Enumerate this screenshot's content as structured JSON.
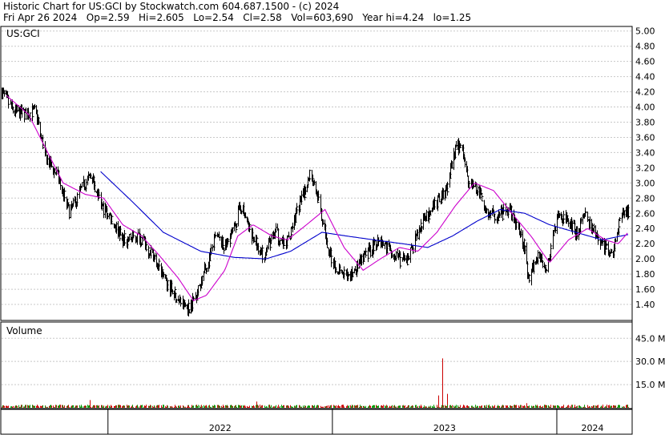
{
  "header": {
    "line1": "Historic Chart for US:GCI by Stockwatch.com 604.687.1500 - (c) 2024",
    "line2": "Fri Apr 26 2024   Op=2.59   Hi=2.605   Lo=2.54   Cl=2.58   Vol=603,690   Year hi=4.24   lo=1.25"
  },
  "chart_data": {
    "type": "line",
    "title": "US:GCI",
    "price_panel_label": "US:GCI",
    "volume_panel_label": "Volume",
    "ylim": [
      1.2,
      5.05
    ],
    "price_ticks": [
      "5.00",
      "4.80",
      "4.60",
      "4.40",
      "4.20",
      "4.00",
      "3.80",
      "3.60",
      "3.40",
      "3.20",
      "3.00",
      "2.80",
      "2.60",
      "2.40",
      "2.20",
      "2.00",
      "1.80",
      "1.60",
      "1.40"
    ],
    "volume_ylim": [
      0,
      55
    ],
    "volume_ticks": [
      "45.0 M",
      "30.0 M",
      "15.0 M"
    ],
    "x_tick_labels": [
      "2022",
      "2023",
      "2024"
    ],
    "x_tick_dates": [
      "2022-01-01",
      "2023-01-01",
      "2024-01-01"
    ],
    "x_start": "2021-07-12",
    "x_end": "2024-04-26",
    "colors": {
      "ma_fast": "#cc00cc",
      "ma_slow": "#0000cc",
      "bar": "#000000",
      "vol_up": "#009900",
      "vol_down": "#cc0000"
    },
    "price_anchors": [
      [
        "2021-07-12",
        4.2
      ],
      [
        "2021-07-30",
        3.95
      ],
      [
        "2021-08-20",
        3.9
      ],
      [
        "2021-09-05",
        3.95
      ],
      [
        "2021-09-20",
        3.35
      ],
      [
        "2021-10-10",
        3.1
      ],
      [
        "2021-10-30",
        2.6
      ],
      [
        "2021-11-20",
        2.95
      ],
      [
        "2021-12-05",
        3.1
      ],
      [
        "2021-12-20",
        2.7
      ],
      [
        "2022-01-05",
        2.55
      ],
      [
        "2022-01-25",
        2.25
      ],
      [
        "2022-02-20",
        2.3
      ],
      [
        "2022-03-15",
        2.05
      ],
      [
        "2022-04-05",
        1.7
      ],
      [
        "2022-04-25",
        1.45
      ],
      [
        "2022-05-12",
        1.35
      ],
      [
        "2022-05-25",
        1.55
      ],
      [
        "2022-06-10",
        1.9
      ],
      [
        "2022-06-25",
        2.3
      ],
      [
        "2022-07-10",
        2.15
      ],
      [
        "2022-07-25",
        2.4
      ],
      [
        "2022-08-05",
        2.7
      ],
      [
        "2022-08-20",
        2.35
      ],
      [
        "2022-09-10",
        2.05
      ],
      [
        "2022-09-30",
        2.35
      ],
      [
        "2022-10-15",
        2.15
      ],
      [
        "2022-11-01",
        2.55
      ],
      [
        "2022-11-15",
        2.85
      ],
      [
        "2022-11-25",
        3.15
      ],
      [
        "2022-12-05",
        2.9
      ],
      [
        "2022-12-15",
        2.5
      ],
      [
        "2022-12-28",
        2.05
      ],
      [
        "2023-01-10",
        1.85
      ],
      [
        "2023-01-25",
        1.75
      ],
      [
        "2023-02-10",
        1.9
      ],
      [
        "2023-02-25",
        2.05
      ],
      [
        "2023-03-15",
        2.25
      ],
      [
        "2023-04-01",
        2.15
      ],
      [
        "2023-04-15",
        2.0
      ],
      [
        "2023-05-01",
        1.95
      ],
      [
        "2023-05-15",
        2.25
      ],
      [
        "2023-06-01",
        2.55
      ],
      [
        "2023-06-20",
        2.75
      ],
      [
        "2023-07-05",
        2.9
      ],
      [
        "2023-07-20",
        3.45
      ],
      [
        "2023-07-31",
        3.5
      ],
      [
        "2023-08-10",
        3.0
      ],
      [
        "2023-08-25",
        2.9
      ],
      [
        "2023-09-10",
        2.6
      ],
      [
        "2023-09-25",
        2.55
      ],
      [
        "2023-10-15",
        2.65
      ],
      [
        "2023-10-30",
        2.4
      ],
      [
        "2023-11-10",
        2.15
      ],
      [
        "2023-11-15",
        1.75
      ],
      [
        "2023-11-30",
        2.05
      ],
      [
        "2023-12-15",
        1.9
      ],
      [
        "2024-01-01",
        2.55
      ],
      [
        "2024-01-15",
        2.55
      ],
      [
        "2024-02-01",
        2.35
      ],
      [
        "2024-02-15",
        2.55
      ],
      [
        "2024-03-01",
        2.35
      ],
      [
        "2024-03-15",
        2.2
      ],
      [
        "2024-03-30",
        2.05
      ],
      [
        "2024-04-10",
        2.4
      ],
      [
        "2024-04-20",
        2.7
      ],
      [
        "2024-04-26",
        2.58
      ]
    ],
    "ma_fast_anchors": [
      [
        "2021-07-20",
        4.15
      ],
      [
        "2021-08-25",
        3.9
      ],
      [
        "2021-09-25",
        3.4
      ],
      [
        "2021-10-20",
        3.0
      ],
      [
        "2021-11-25",
        2.85
      ],
      [
        "2021-12-25",
        2.8
      ],
      [
        "2022-01-25",
        2.45
      ],
      [
        "2022-02-25",
        2.3
      ],
      [
        "2022-03-25",
        2.05
      ],
      [
        "2022-04-25",
        1.75
      ],
      [
        "2022-05-20",
        1.45
      ],
      [
        "2022-06-10",
        1.52
      ],
      [
        "2022-07-10",
        1.85
      ],
      [
        "2022-07-31",
        2.3
      ],
      [
        "2022-08-25",
        2.45
      ],
      [
        "2022-09-25",
        2.3
      ],
      [
        "2022-10-20",
        2.25
      ],
      [
        "2022-11-20",
        2.45
      ],
      [
        "2022-12-20",
        2.65
      ],
      [
        "2023-01-20",
        2.15
      ],
      [
        "2023-02-20",
        1.85
      ],
      [
        "2023-03-20",
        2.0
      ],
      [
        "2023-04-20",
        2.15
      ],
      [
        "2023-05-20",
        2.1
      ],
      [
        "2023-06-20",
        2.35
      ],
      [
        "2023-07-20",
        2.7
      ],
      [
        "2023-08-20",
        3.0
      ],
      [
        "2023-09-20",
        2.9
      ],
      [
        "2023-10-20",
        2.6
      ],
      [
        "2023-11-20",
        2.3
      ],
      [
        "2023-12-20",
        1.95
      ],
      [
        "2024-01-20",
        2.25
      ],
      [
        "2024-02-20",
        2.4
      ],
      [
        "2024-03-20",
        2.25
      ],
      [
        "2024-04-10",
        2.2
      ],
      [
        "2024-04-26",
        2.35
      ]
    ],
    "ma_slow_anchors": [
      [
        "2021-12-20",
        3.15
      ],
      [
        "2022-02-10",
        2.75
      ],
      [
        "2022-04-01",
        2.35
      ],
      [
        "2022-06-01",
        2.1
      ],
      [
        "2022-07-25",
        2.02
      ],
      [
        "2022-09-15",
        2.0
      ],
      [
        "2022-10-25",
        2.1
      ],
      [
        "2022-12-15",
        2.35
      ],
      [
        "2023-01-25",
        2.3
      ],
      [
        "2023-03-10",
        2.25
      ],
      [
        "2023-04-25",
        2.2
      ],
      [
        "2023-06-05",
        2.15
      ],
      [
        "2023-07-15",
        2.3
      ],
      [
        "2023-08-25",
        2.5
      ],
      [
        "2023-10-01",
        2.65
      ],
      [
        "2023-11-10",
        2.6
      ],
      [
        "2023-12-20",
        2.45
      ],
      [
        "2024-02-01",
        2.35
      ],
      [
        "2024-03-15",
        2.25
      ],
      [
        "2024-04-26",
        2.32
      ]
    ],
    "volume_spikes": [
      [
        "2023-06-29",
        32
      ],
      [
        "2023-06-22",
        8
      ],
      [
        "2023-07-06",
        9
      ],
      [
        "2022-08-31",
        4
      ],
      [
        "2021-12-02",
        5
      ],
      [
        "2023-11-13",
        3
      ]
    ]
  }
}
